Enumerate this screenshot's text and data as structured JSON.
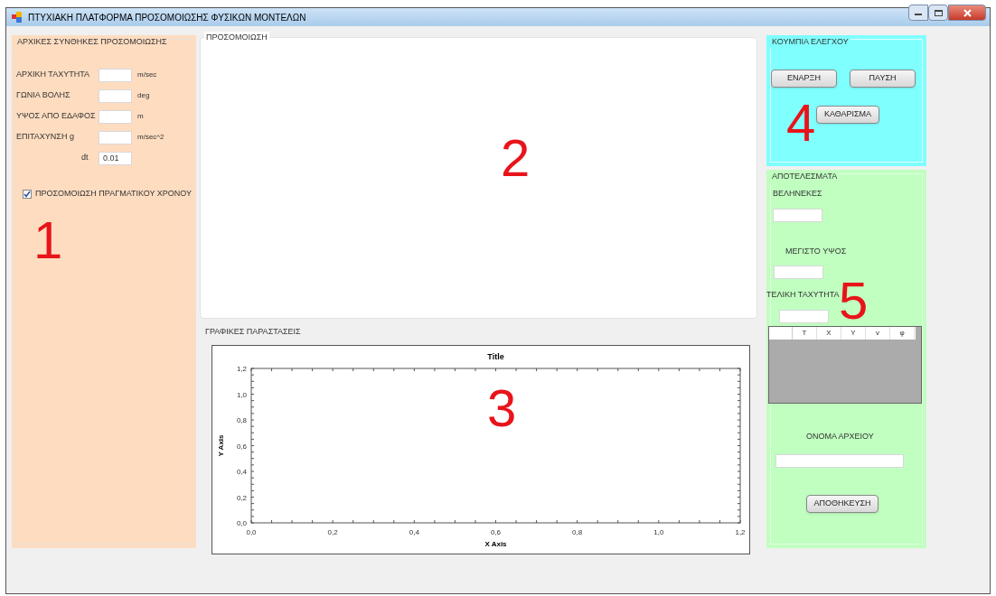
{
  "window": {
    "title": "ΠΤΥΧΙΑΚΗ ΠΛΑΤΦΟΡΜΑ ΠΡΟΣΟΜΟΙΩΣΗΣ ΦΥΣΙΚΩΝ ΜΟΝΤΕΛΩΝ"
  },
  "initial_conditions": {
    "title": "ΑΡΧΙΚΕΣ ΣΥΝΘΗΚΕΣ ΠΡΟΣΟΜΟΙΩΣΗΣ",
    "fields": [
      {
        "label": "ΑΡΧΙΚΗ ΤΑΧΥΤΗΤΑ",
        "unit": "m/sec"
      },
      {
        "label": "ΓΩΝΙΑ ΒΟΛΗΣ",
        "unit": "deg"
      },
      {
        "label": "ΥΨΟΣ ΑΠΟ ΕΔΑΦΟΣ",
        "unit": "m"
      },
      {
        "label": "ΕΠΙΤΑΧΥΝΣΗ g",
        "unit": "m/sec^2"
      }
    ],
    "dt": {
      "label": "dt",
      "value": "0.01"
    },
    "realtime": {
      "label": "ΠΡΟΣΟΜΟΙΩΣΗ ΠΡΑΓΜΑΤΙΚΟΥ ΧΡΟΝΟΥ",
      "checked": true
    }
  },
  "simulation": {
    "title": "ΠΡΟΣΟΜΟΙΩΣΗ"
  },
  "graphs": {
    "title": "ΓΡΑΦΙΚΕΣ ΠΑΡΑΣΤΑΣΕΙΣ",
    "chart_data": {
      "type": "line",
      "title": "Title",
      "xlabel": "X Axis",
      "ylabel": "Y Axis",
      "xlim": [
        0,
        1.2
      ],
      "ylim": [
        0,
        1.2
      ],
      "xticks": [
        {
          "value": 0,
          "label": "0,0"
        },
        {
          "value": 0.2,
          "label": "0,2"
        },
        {
          "value": 0.4,
          "label": "0,4"
        },
        {
          "value": 0.6,
          "label": "0,6"
        },
        {
          "value": 0.8,
          "label": "0,8"
        },
        {
          "value": 1,
          "label": "1,0"
        },
        {
          "value": 1.2,
          "label": "1,2"
        }
      ],
      "yticks": [
        {
          "value": 0,
          "label": "0,0"
        },
        {
          "value": 0.2,
          "label": "0,2"
        },
        {
          "value": 0.4,
          "label": "0,4"
        },
        {
          "value": 0.6,
          "label": "0,6"
        },
        {
          "value": 0.8,
          "label": "0,8"
        },
        {
          "value": 1,
          "label": "1,0"
        },
        {
          "value": 1.2,
          "label": "1,2"
        }
      ]
    }
  },
  "controls": {
    "title": "ΚΟΥΜΠΙΑ ΕΛΕΓΧΟΥ",
    "buttons": [
      "ΕΝΑΡΞΗ",
      "ΠΑΥΣΗ",
      "ΚΑΘΑΡΙΣΜΑ"
    ]
  },
  "results": {
    "title": "ΑΠΟΤΕΛΕΣΜΑΤΑ",
    "outputs": [
      {
        "label": "ΒΕΛΗΝΕΚΕΣ"
      },
      {
        "label": "ΜΕΓΙΣΤΟ ΥΨΟΣ"
      },
      {
        "label": "ΤΕΛΙΚΗ ΤΑΧΥΤΗΤΑ"
      }
    ],
    "table": {
      "columns": [
        "T",
        "X",
        "Y",
        "v",
        "φ"
      ]
    },
    "filename": {
      "label": "ΟΝΟΜΑ ΑΡΧΕΙΟΥ"
    },
    "save_button": "ΑΠΟΘΗΚΕΥΣΗ"
  },
  "annotations": [
    "1",
    "2",
    "3",
    "4",
    "5"
  ]
}
